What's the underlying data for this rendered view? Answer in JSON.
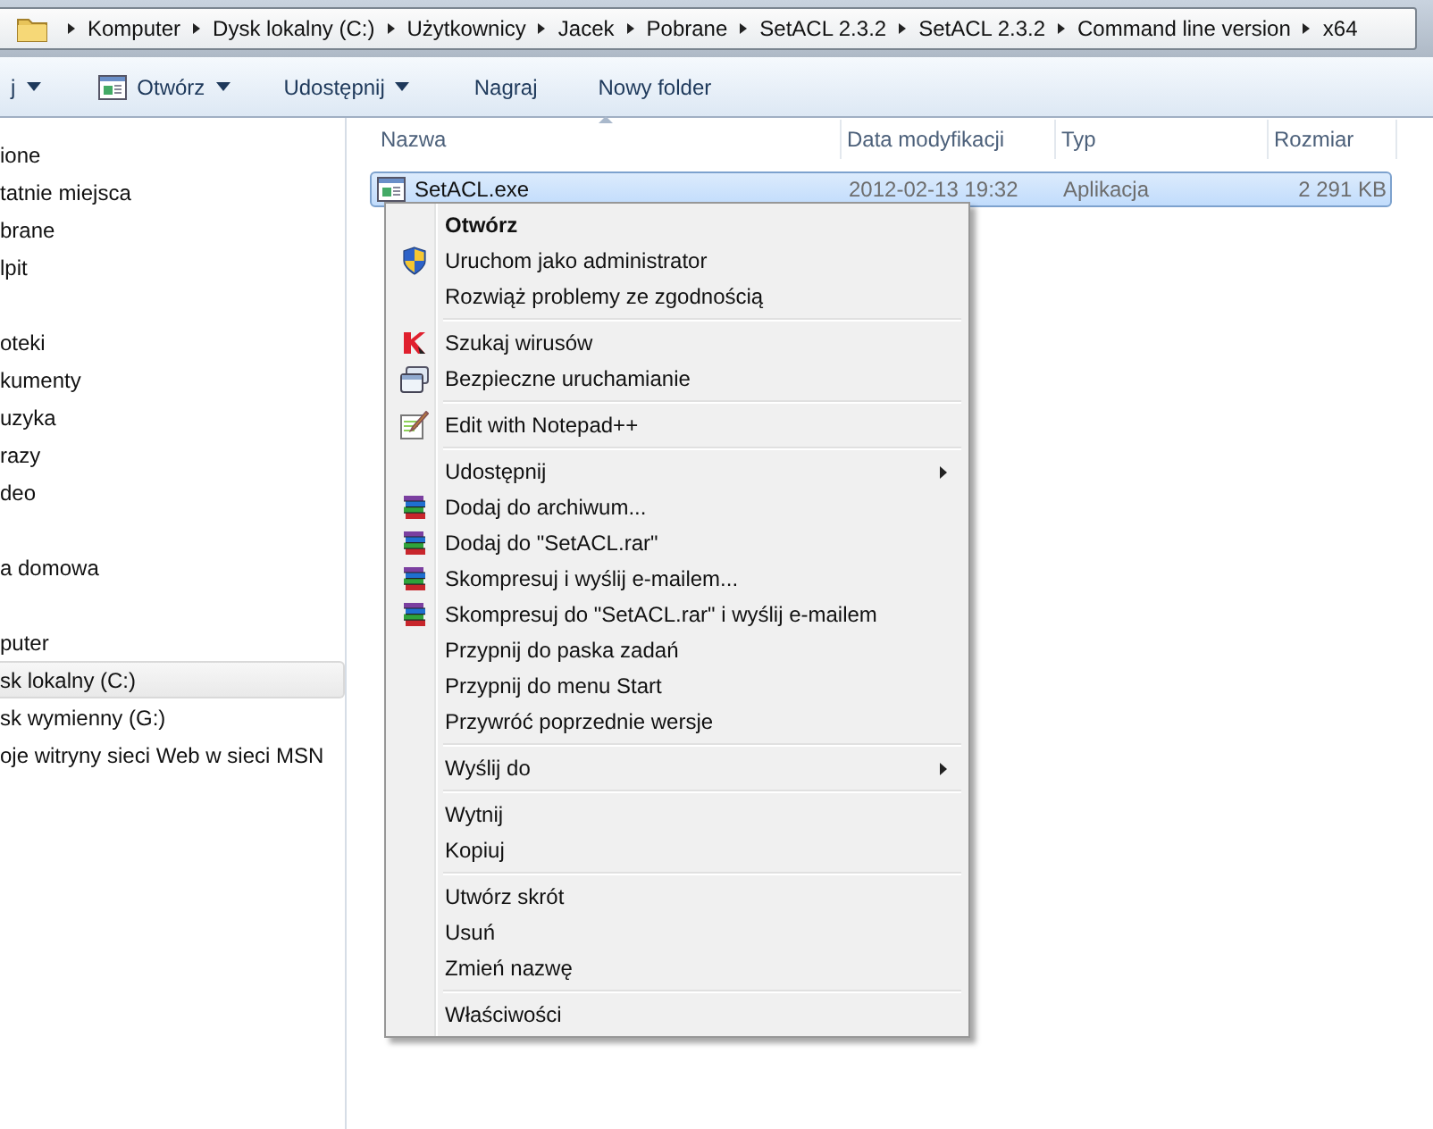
{
  "address_bar": {
    "crumbs": [
      "Komputer",
      "Dysk lokalny (C:)",
      "Użytkownicy",
      "Jacek",
      "Pobrane",
      "SetACL 2.3.2",
      "SetACL 2.3.2",
      "Command line version",
      "x64"
    ]
  },
  "toolbar": [
    {
      "label": "j",
      "dropdown": true
    },
    {
      "label": "Otwórz",
      "dropdown": true
    },
    {
      "label": "Udostępnij",
      "dropdown": true
    },
    {
      "label": "Nagraj",
      "dropdown": false
    },
    {
      "label": "Nowy folder",
      "dropdown": false
    }
  ],
  "nav_pane": {
    "groups": [
      {
        "items": [
          {
            "label": "ione",
            "selected": false
          },
          {
            "label": "tatnie miejsca",
            "selected": false
          },
          {
            "label": "brane",
            "selected": false
          },
          {
            "label": "lpit",
            "selected": false
          }
        ]
      },
      {
        "items": [
          {
            "label": "oteki",
            "selected": false
          },
          {
            "label": "kumenty",
            "selected": false
          },
          {
            "label": "uzyka",
            "selected": false
          },
          {
            "label": "razy",
            "selected": false
          },
          {
            "label": "deo",
            "selected": false
          }
        ]
      },
      {
        "items": [
          {
            "label": "a domowa",
            "selected": false
          }
        ]
      },
      {
        "items": [
          {
            "label": "puter",
            "selected": false
          },
          {
            "label": "sk lokalny (C:)",
            "selected": true
          },
          {
            "label": "sk wymienny (G:)",
            "selected": false
          },
          {
            "label": "oje witryny sieci Web w sieci MSN",
            "selected": false
          }
        ]
      }
    ]
  },
  "file_list": {
    "columns": [
      "Nazwa",
      "Data modyfikacji",
      "Typ",
      "Rozmiar"
    ],
    "rows": [
      {
        "name": "SetACL.exe",
        "modified": "2012-02-13 19:32",
        "type": "Aplikacja",
        "size": "2 291 KB",
        "selected": true
      }
    ]
  },
  "context_menu": {
    "items": [
      {
        "kind": "default",
        "label": "Otwórz",
        "submenu": false
      },
      {
        "kind": "shield",
        "label": "Uruchom jako administrator",
        "submenu": false
      },
      {
        "kind": "plain",
        "label": "Rozwiąż problemy ze zgodnością",
        "submenu": false
      },
      {
        "kind": "separator"
      },
      {
        "kind": "scan",
        "label": "Szukaj wirusów",
        "submenu": false
      },
      {
        "kind": "sandbox",
        "label": "Bezpieczne uruchamianie",
        "submenu": false
      },
      {
        "kind": "separator"
      },
      {
        "kind": "editor",
        "label": "Edit with Notepad++",
        "submenu": false
      },
      {
        "kind": "separator"
      },
      {
        "kind": "plain",
        "label": "Udostępnij",
        "submenu": true
      },
      {
        "kind": "archive",
        "label": "Dodaj do archiwum...",
        "submenu": false
      },
      {
        "kind": "archive",
        "label": "Dodaj do \"SetACL.rar\"",
        "submenu": false
      },
      {
        "kind": "archive",
        "label": "Skompresuj i wyślij e-mailem...",
        "submenu": false
      },
      {
        "kind": "archive",
        "label": "Skompresuj do \"SetACL.rar\" i wyślij e-mailem",
        "submenu": false
      },
      {
        "kind": "plain",
        "label": "Przypnij do paska zadań",
        "submenu": false
      },
      {
        "kind": "plain",
        "label": "Przypnij do menu Start",
        "submenu": false
      },
      {
        "kind": "plain",
        "label": "Przywróć poprzednie wersje",
        "submenu": false
      },
      {
        "kind": "separator"
      },
      {
        "kind": "plain",
        "label": "Wyślij do",
        "submenu": true
      },
      {
        "kind": "separator"
      },
      {
        "kind": "plain",
        "label": "Wytnij",
        "submenu": false
      },
      {
        "kind": "plain",
        "label": "Kopiuj",
        "submenu": false
      },
      {
        "kind": "separator"
      },
      {
        "kind": "plain",
        "label": "Utwórz skrót",
        "submenu": false
      },
      {
        "kind": "plain",
        "label": "Usuń",
        "submenu": false
      },
      {
        "kind": "plain",
        "label": "Zmień nazwę",
        "submenu": false
      },
      {
        "kind": "separator"
      },
      {
        "kind": "plain",
        "label": "Właściwości",
        "submenu": false
      }
    ]
  }
}
